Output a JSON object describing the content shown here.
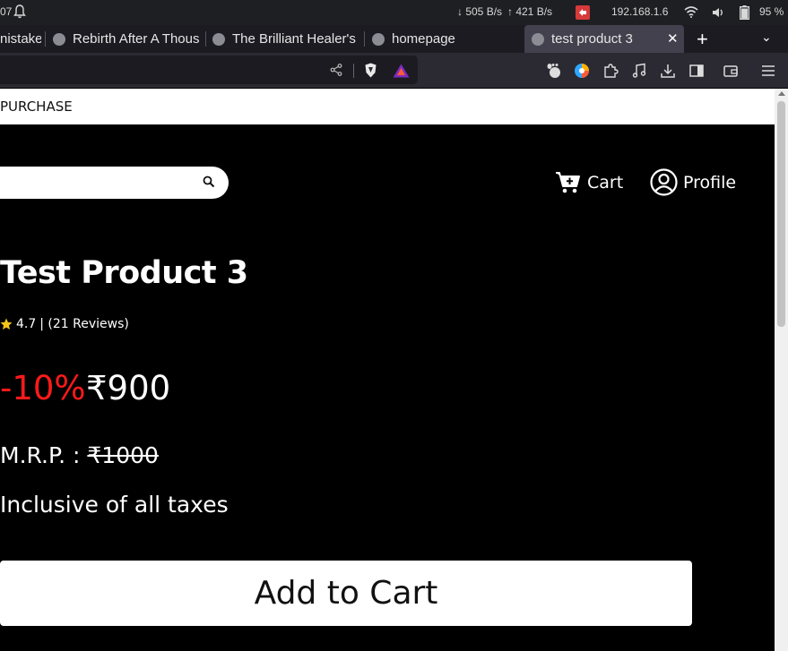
{
  "system": {
    "clock_fragment": "07",
    "net_down": "↓ 505 B/s",
    "net_up": "↑ 421 B/s",
    "ip_address": "192.168.1.6",
    "battery": "95 %"
  },
  "tabs": [
    {
      "title": "nistake",
      "active": false
    },
    {
      "title": "Rebirth After A Thous",
      "active": false
    },
    {
      "title": "The Brilliant Healer's",
      "active": false
    },
    {
      "title": "homepage",
      "active": false
    },
    {
      "title": "test product 3",
      "active": true
    }
  ],
  "tab_close_glyph": "✕",
  "new_tab_glyph": "+",
  "tab_menu_glyph": "⌄",
  "page": {
    "promo_text": "PURCHASE",
    "nav": {
      "cart_label": "Cart",
      "profile_label": "Profile"
    },
    "product": {
      "title": "Test Product 3",
      "rating": "4.7",
      "reviews_text": "| (21 Reviews)",
      "discount": "-10%",
      "price": "₹900",
      "mrp_label": "M.R.P. : ",
      "mrp_value": "₹1000",
      "tax_note": "Inclusive of all taxes",
      "add_to_cart_label": "Add to Cart"
    }
  },
  "colors": {
    "discount": "#ff1a1a",
    "page_bg": "#000000",
    "star": "#f5c518"
  }
}
